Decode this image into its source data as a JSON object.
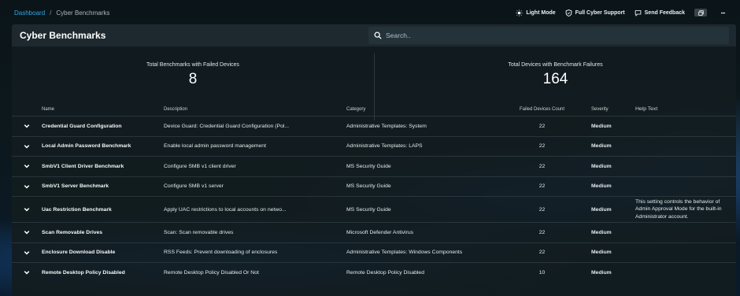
{
  "breadcrumb": {
    "root": "Dashboard",
    "separator": "/",
    "current": "Cyber Benchmarks"
  },
  "top_actions": [
    {
      "icon": "sun-icon",
      "label": "Light Mode"
    },
    {
      "icon": "shield-icon",
      "label": "Full Cyber Support"
    },
    {
      "icon": "chat-icon",
      "label": "Send Feedback"
    }
  ],
  "panel": {
    "title": "Cyber Benchmarks",
    "search_placeholder": "Search.."
  },
  "stats": [
    {
      "label": "Total Benchmarks with Failed Devices",
      "value": "8"
    },
    {
      "label": "Total Devices with Benchmark Failures",
      "value": "164"
    }
  ],
  "table": {
    "columns": [
      "Name",
      "Description",
      "Category",
      "Failed Devices Count",
      "Severity",
      "Help Text"
    ],
    "rows": [
      {
        "name": "Credential Guard Configuration",
        "description": "Device Guard: Credential Guard Configuration (Pol...",
        "category": "Administrative Templates: System",
        "count": "22",
        "severity": "Medium",
        "help": ""
      },
      {
        "name": "Local Admin Password Benchmark",
        "description": "Enable local admin password management",
        "category": "Administrative Templates: LAPS",
        "count": "22",
        "severity": "Medium",
        "help": ""
      },
      {
        "name": "SmbV1 Client Driver Benchmark",
        "description": "Configure SMB v1 client driver",
        "category": "MS Security Guide",
        "count": "22",
        "severity": "Medium",
        "help": ""
      },
      {
        "name": "SmbV1 Server Benchmark",
        "description": "Configure SMB v1 server",
        "category": "MS Security Guide",
        "count": "22",
        "severity": "Medium",
        "help": ""
      },
      {
        "name": "Uac Restriction Benchmark",
        "description": "Apply UAC restrictions to local accounts on netwo...",
        "category": "MS Security Guide",
        "count": "22",
        "severity": "Medium",
        "help": "This setting controls the behavior of Admin Approval Mode for the built-in Administrator account."
      },
      {
        "name": "Scan Removable Drives",
        "description": "Scan: Scan removable drives",
        "category": "Microsoft Defender Antivirus",
        "count": "22",
        "severity": "Medium",
        "help": ""
      },
      {
        "name": "Enclosure Download Disable",
        "description": "RSS Feeds: Prevent downloading of enclosures",
        "category": "Administrative Templates: Windows Components",
        "count": "22",
        "severity": "Medium",
        "help": ""
      },
      {
        "name": "Remote Desktop Policy Disabled",
        "description": "Remote Desktop Policy Disabled Or Not",
        "category": "Remote Desktop Policy Disabled",
        "count": "10",
        "severity": "Medium",
        "help": ""
      }
    ]
  },
  "colors": {
    "accent": "#2fa4e7",
    "panel": "#121c20",
    "header": "#1d292e",
    "search": "#24323a"
  }
}
